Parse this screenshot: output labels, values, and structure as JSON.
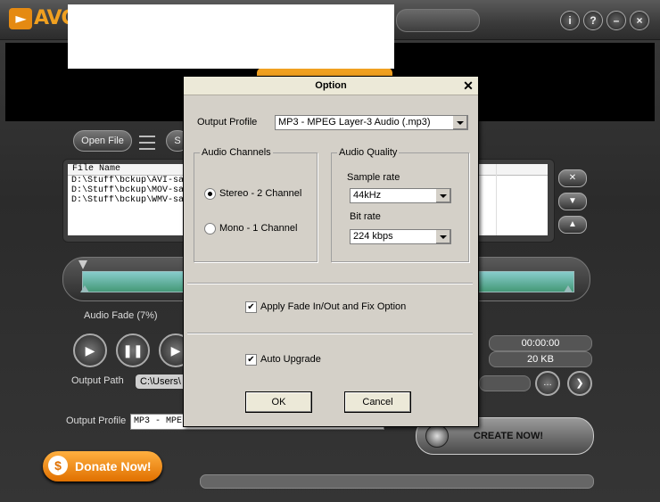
{
  "app": {
    "logo_text": "AVGO",
    "open_file_label": "Open File",
    "second_button_label": "S",
    "file_list": {
      "header": "File Name",
      "rows": [
        "D:\\Stuff\\bckup\\AVI-sa",
        "D:\\Stuff\\bckup\\MOV-sa",
        "D:\\Stuff\\bckup\\WMV-sa"
      ]
    },
    "audio_fade_label": "Audio Fade (7%)",
    "output_path_label": "Output Path",
    "output_path_value": "C:\\Users\\",
    "time_value": "00:00:00",
    "size_value": "20 KB",
    "output_profile_label": "Output Profile",
    "output_profile_value": "MP3 - MPE",
    "create_button": "CREATE NOW!",
    "donate_button": "Donate Now!",
    "top_buttons": [
      "i",
      "?",
      "–",
      "×"
    ]
  },
  "dialog": {
    "title": "Option",
    "close_glyph": "✕",
    "output_profile_label": "Output Profile",
    "output_profile_value": "MP3 - MPEG Layer-3 Audio (.mp3)",
    "audio_channels": {
      "legend": "Audio Channels",
      "options": [
        "Stereo - 2 Channel",
        "Mono - 1 Channel"
      ],
      "selected": "Stereo - 2 Channel"
    },
    "audio_quality": {
      "legend": "Audio Quality",
      "sample_rate_label": "Sample rate",
      "sample_rate_value": "44kHz",
      "bit_rate_label": "Bit rate",
      "bit_rate_value": "224 kbps"
    },
    "fade_option": {
      "label": "Apply Fade In/Out and Fix Option",
      "checked": true,
      "mark": "✔"
    },
    "auto_upgrade": {
      "label": "Auto Upgrade",
      "checked": true,
      "mark": "✔"
    },
    "ok_label": "OK",
    "cancel_label": "Cancel"
  }
}
